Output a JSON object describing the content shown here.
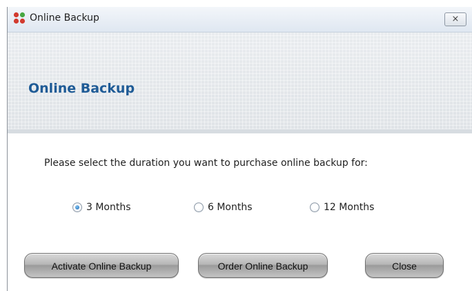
{
  "window": {
    "title": "Online Backup",
    "close_symbol": "⨯",
    "icon": "app-icon"
  },
  "header": {
    "title": "Online Backup"
  },
  "prompt": "Please select the duration you want to purchase online backup for:",
  "duration_options": [
    {
      "label": "3 Months",
      "selected": true
    },
    {
      "label": "6 Months",
      "selected": false
    },
    {
      "label": "12 Months",
      "selected": false
    }
  ],
  "buttons": {
    "activate": "Activate Online Backup",
    "order": "Order Online Backup",
    "close": "Close"
  },
  "colors": {
    "header_title": "#1f5b96",
    "radio_selected": "#1b66b3"
  }
}
